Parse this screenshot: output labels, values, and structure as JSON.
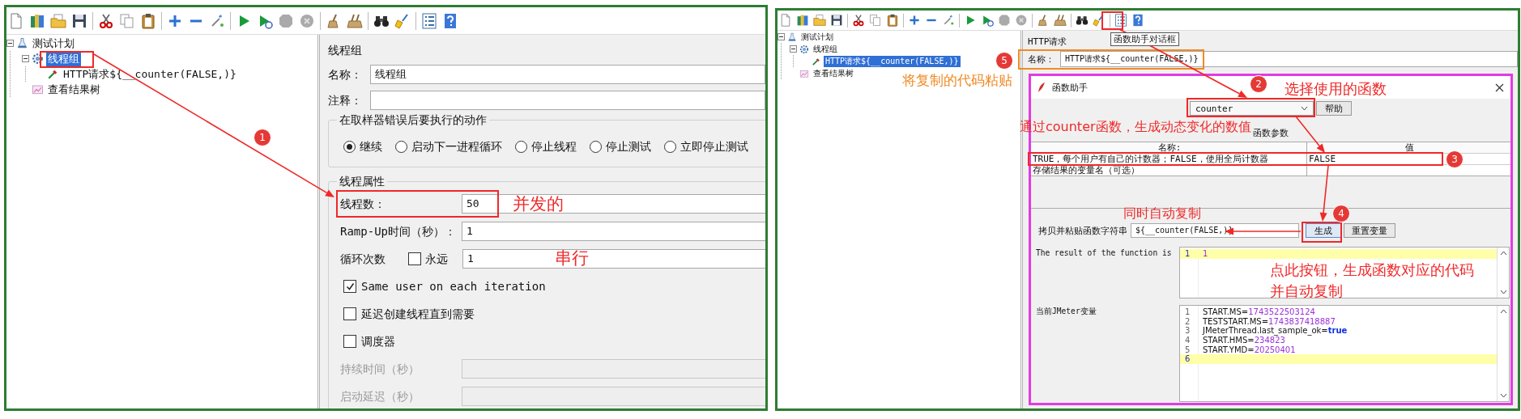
{
  "left_window": {
    "tree": [
      {
        "label": "测试计划",
        "kind": "plan",
        "selected": false,
        "children": [
          {
            "label": "线程组",
            "kind": "threadgroup",
            "selected": true,
            "children": [
              {
                "label": "HTTP请求${__counter(FALSE,)}",
                "kind": "sampler",
                "selected": false
              }
            ]
          },
          {
            "label": "查看结果树",
            "kind": "listener",
            "selected": false
          }
        ]
      }
    ],
    "form": {
      "title": "线程组",
      "name_label": "名称：",
      "name_value": "线程组",
      "comment_label": "注释：",
      "error_action": {
        "title": "在取样器错误后要执行的动作",
        "options": [
          {
            "label": "继续",
            "selected": true
          },
          {
            "label": "启动下一进程循环",
            "selected": false
          },
          {
            "label": "停止线程",
            "selected": false
          },
          {
            "label": "停止测试",
            "selected": false
          },
          {
            "label": "立即停止测试",
            "selected": false
          }
        ]
      },
      "thread_properties": {
        "title": "线程属性",
        "rows": [
          {
            "kind": "text",
            "label": "线程数：",
            "value": "50",
            "disabled": false
          },
          {
            "kind": "text",
            "label": "Ramp-Up时间（秒）：",
            "value": "1",
            "disabled": false
          },
          {
            "kind": "loop",
            "label": "循环次数",
            "forever_label": "永远",
            "forever_checked": false,
            "value": "1",
            "disabled": false
          },
          {
            "kind": "checkbox",
            "label": "Same user on each iteration",
            "checked": true
          },
          {
            "kind": "checkbox",
            "label": "延迟创建线程直到需要",
            "checked": false
          },
          {
            "kind": "checkbox",
            "label": "调度器",
            "checked": false
          },
          {
            "kind": "text",
            "label": "持续时间（秒）",
            "disabled": true
          },
          {
            "kind": "text",
            "label": "启动延迟（秒）",
            "disabled": true
          }
        ]
      }
    },
    "annotations": {
      "badges": [
        "1"
      ],
      "notes": [
        {
          "text": "并发的",
          "color": "#f02828"
        },
        {
          "text": "串行",
          "color": "#f02828"
        }
      ]
    }
  },
  "right_window": {
    "tree": [
      {
        "label": "测试计划",
        "kind": "plan",
        "selected": false,
        "children": [
          {
            "label": "线程组",
            "kind": "threadgroup",
            "selected": false,
            "children": [
              {
                "label": "HTTP请求${__counter(FALSE,)}",
                "kind": "sampler",
                "selected": true
              }
            ]
          },
          {
            "label": "查看结果树",
            "kind": "listener",
            "selected": false
          }
        ]
      }
    ],
    "tooltip": "函数助手对话框",
    "form": {
      "title": "HTTP请求",
      "name_label": "名称：",
      "name_value": "HTTP请求${__counter(FALSE,)}"
    },
    "dialog": {
      "title": "函数助手",
      "function": "counter",
      "help_button": "帮助",
      "params_title": "函数参数",
      "columns": [
        "名称:",
        "值"
      ],
      "params": [
        {
          "name": "TRUE，每个用户有自己的计数器；FALSE，使用全局计数器",
          "value": "FALSE"
        },
        {
          "name": "存储结果的变量名（可选）"
        }
      ],
      "copy_label": "拷贝并粘贴函数字符串",
      "copy_value": "${__counter(FALSE,)}",
      "buttons": [
        "生成",
        "重置变量"
      ],
      "result_label": "The result of the function is",
      "result_lines": [
        {
          "number": "1",
          "value": "1",
          "kind": "number",
          "current": true
        }
      ],
      "vars_label": "当前JMeter变量",
      "vars_lines": [
        {
          "number": "1",
          "key": "START.MS=",
          "value": "1743522503124",
          "kind": "number",
          "current": false
        },
        {
          "number": "2",
          "key": "TESTSTART.MS=",
          "value": "1743837418887",
          "kind": "number",
          "current": false
        },
        {
          "number": "3",
          "key": "JMeterThread.last_sample_ok=",
          "value": "true",
          "kind": "keyword",
          "current": false
        },
        {
          "number": "4",
          "key": "START.HMS=",
          "value": "234823",
          "kind": "number",
          "current": false
        },
        {
          "number": "5",
          "key": "START.YMD=",
          "value": "20250401",
          "kind": "number",
          "current": false
        },
        {
          "number": "6",
          "current": true
        }
      ]
    },
    "annotations": {
      "badges": [
        "5",
        "2",
        "3",
        "4"
      ],
      "notes": [
        {
          "text": "将复制的代码粘贴",
          "color": "#f08a24"
        },
        {
          "text": "选择使用的函数",
          "color": "#f02828"
        },
        {
          "text": "通过counter函数，生成动态变化的数值",
          "color": "#f02828"
        },
        {
          "text": "同时自动复制",
          "color": "#f02828"
        },
        {
          "text": "点此按钮，生成函数对应的代码并自动复制",
          "color": "#f02828"
        }
      ]
    }
  }
}
